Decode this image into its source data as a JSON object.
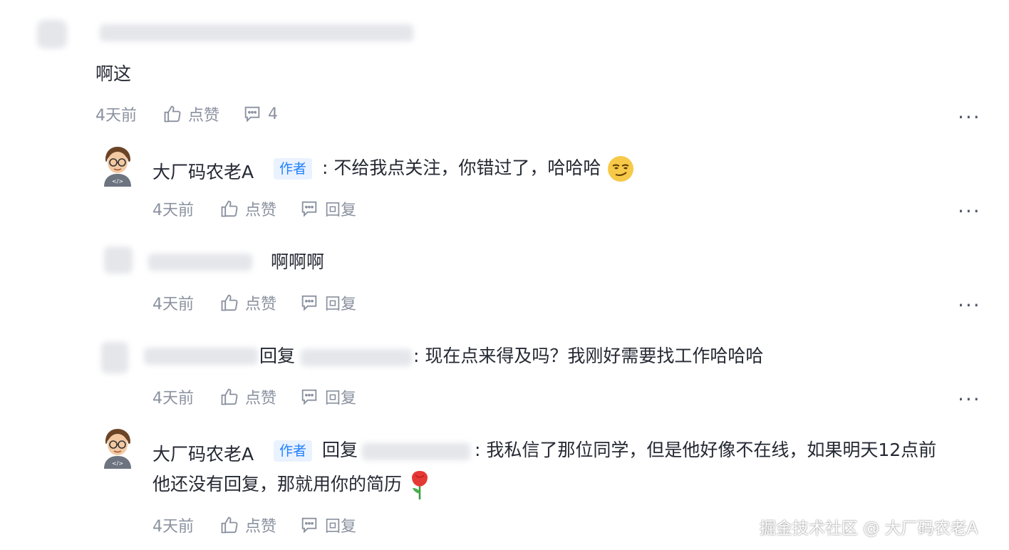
{
  "top_comment": {
    "text": "啊这",
    "time": "4天前",
    "like_label": "点赞",
    "comment_count": "4"
  },
  "replies": [
    {
      "author": "大厂码农老A",
      "badge": "作者",
      "text": ": 不给我点关注，你错过了，哈哈哈",
      "time": "4天前",
      "like_label": "点赞",
      "reply_label": "回复"
    },
    {
      "text": "啊啊啊",
      "time": "4天前",
      "like_label": "点赞",
      "reply_label": "回复"
    },
    {
      "reply_word": "回复",
      "text": ": 现在点来得及吗？我刚好需要找工作哈哈哈",
      "time": "4天前",
      "like_label": "点赞",
      "reply_label": "回复"
    },
    {
      "author": "大厂码农老A",
      "badge": "作者",
      "reply_word": "回复",
      "text_line1": ": 我私信了那位同学，但是他好像不在线，如果明天12点前",
      "text_line2": "他还没有回复，那就用你的简历",
      "time": "4天前",
      "like_label": "点赞",
      "reply_label": "回复"
    }
  ],
  "more_icon": "...",
  "icons": [
    "thumbs-up-icon",
    "comment-icon",
    "more-icon",
    "smirk-emoji",
    "rose-emoji"
  ],
  "watermark": "掘金技术社区 @ 大厂码农老A"
}
